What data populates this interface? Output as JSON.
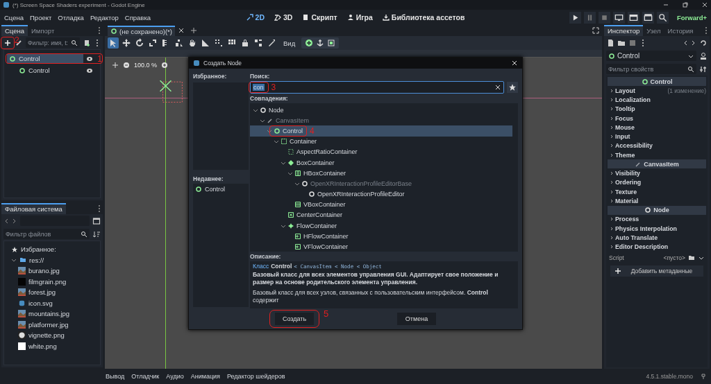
{
  "window": {
    "title": "(*) Screen Space Shaders experiment - Godot Engine"
  },
  "menu": [
    "Сцена",
    "Проект",
    "Отладка",
    "Редактор",
    "Справка"
  ],
  "workspaces": [
    {
      "label": "2D",
      "kind": "canvas",
      "selected": true
    },
    {
      "label": "3D",
      "kind": "cube",
      "selected": false
    },
    {
      "label": "Скрипт",
      "kind": "script",
      "selected": false
    },
    {
      "label": "Игра",
      "kind": "game",
      "selected": false
    },
    {
      "label": "Библиотека ассетов",
      "kind": "assets",
      "selected": false
    }
  ],
  "renderer": "Forward+",
  "scene_dock": {
    "tabs": [
      {
        "label": "Сцена",
        "selected": true
      },
      {
        "label": "Импорт",
        "selected": false
      }
    ],
    "add_callout": "2",
    "filter_placeholder": "Фильтр: имя, t:",
    "tree": [
      {
        "name": "Control",
        "selected": true,
        "callout": "1",
        "children": [
          {
            "name": "Control",
            "selected": false
          }
        ]
      }
    ]
  },
  "filesystem": {
    "tab": "Файловая система",
    "filter_placeholder": "Фильтр файлов",
    "favorites": "Избранное:",
    "root": {
      "name": "res://",
      "expanded": true,
      "children": [
        {
          "name": "burano.jpg",
          "kind": "photo"
        },
        {
          "name": "filmgrain.png",
          "kind": "dark"
        },
        {
          "name": "forest.jpg",
          "kind": "photo"
        },
        {
          "name": "icon.svg",
          "kind": "logo"
        },
        {
          "name": "mountains.jpg",
          "kind": "photo"
        },
        {
          "name": "platformer.jpg",
          "kind": "photo"
        },
        {
          "name": "vignette.png",
          "kind": "vignette"
        },
        {
          "name": "white.png",
          "kind": "white"
        }
      ]
    }
  },
  "editor": {
    "tab": "(не сохранено)(*)",
    "view_menu": "Вид",
    "zoom": "100.0 %"
  },
  "dialog": {
    "title": "Создать Node",
    "favorites_label": "Избранное:",
    "recent_label": "Недавнее:",
    "recent": [
      "Control"
    ],
    "search_label": "Поиск:",
    "search_value": "con",
    "search_callout": "3",
    "matches_label": "Совпадения:",
    "tree": [
      {
        "name": "Node",
        "kind": "node",
        "expanded": true,
        "selected": false,
        "disabled": false,
        "children": [
          {
            "name": "CanvasItem",
            "kind": "pencil",
            "expanded": true,
            "selected": false,
            "disabled": true,
            "children": [
              {
                "name": "Control",
                "kind": "control",
                "expanded": true,
                "selected": true,
                "disabled": false,
                "callout": "4",
                "children": [
                  {
                    "name": "Container",
                    "kind": "container",
                    "expanded": true,
                    "selected": false,
                    "disabled": false,
                    "children": [
                      {
                        "name": "AspectRatioContainer",
                        "kind": "dotted",
                        "selected": false,
                        "disabled": false
                      },
                      {
                        "name": "BoxContainer",
                        "kind": "diamond",
                        "expanded": true,
                        "selected": false,
                        "disabled": false,
                        "children": [
                          {
                            "name": "HBoxContainer",
                            "kind": "hbox",
                            "expanded": true,
                            "selected": false,
                            "disabled": false,
                            "children": [
                              {
                                "name": "OpenXRInteractionProfileEditorBase",
                                "kind": "node",
                                "expanded": true,
                                "selected": false,
                                "disabled": true,
                                "children": [
                                  {
                                    "name": "OpenXRInteractionProfileEditor",
                                    "kind": "node",
                                    "selected": false,
                                    "disabled": false
                                  }
                                ]
                              }
                            ]
                          },
                          {
                            "name": "VBoxContainer",
                            "kind": "vbox",
                            "selected": false,
                            "disabled": false
                          }
                        ]
                      },
                      {
                        "name": "CenterContainer",
                        "kind": "center",
                        "selected": false,
                        "disabled": false
                      },
                      {
                        "name": "FlowContainer",
                        "kind": "flow",
                        "expanded": true,
                        "selected": false,
                        "disabled": false,
                        "children": [
                          {
                            "name": "HFlowContainer",
                            "kind": "hflow",
                            "selected": false,
                            "disabled": false
                          },
                          {
                            "name": "VFlowContainer",
                            "kind": "hflow",
                            "selected": false,
                            "disabled": false
                          }
                        ]
                      }
                    ]
                  }
                ]
              }
            ]
          }
        ]
      }
    ],
    "description_label": "Описание:",
    "description": {
      "class_word": "Класс",
      "class_name": "Control",
      "inheritance": "< CanvasItem < Node < Object",
      "summary": "Базовый класс для всех элементов управления GUI. Адаптирует свое положение и размер на основе родительского элемента управления.",
      "body": "Базовый класс для всех узлов, связанных с пользовательским интерфейсом. **Control** содержит"
    },
    "create_button": "Создать",
    "create_callout": "5",
    "cancel_button": "Отмена"
  },
  "inspector": {
    "tabs": [
      {
        "label": "Инспектор",
        "selected": true
      },
      {
        "label": "Узел",
        "selected": false
      },
      {
        "label": "История",
        "selected": false
      }
    ],
    "node": "Control",
    "filter_placeholder": "Фильтр свойств",
    "sections": [
      {
        "title": "Control",
        "kind": "control",
        "groups": [
          {
            "label": "Layout",
            "note": "(1 изменение)"
          },
          {
            "label": "Localization"
          },
          {
            "label": "Tooltip"
          },
          {
            "label": "Focus"
          },
          {
            "label": "Mouse"
          },
          {
            "label": "Input"
          },
          {
            "label": "Accessibility"
          },
          {
            "label": "Theme"
          }
        ]
      },
      {
        "title": "CanvasItem",
        "kind": "canvasitem",
        "groups": [
          {
            "label": "Visibility"
          },
          {
            "label": "Ordering"
          },
          {
            "label": "Texture"
          },
          {
            "label": "Material"
          }
        ]
      },
      {
        "title": "Node",
        "kind": "node",
        "groups": [
          {
            "label": "Process"
          },
          {
            "label": "Physics Interpolation"
          },
          {
            "label": "Auto Translate"
          },
          {
            "label": "Editor Description"
          }
        ]
      }
    ],
    "script_label": "Script",
    "script_value": "<пусто>",
    "add_metadata": "Добавить метаданные"
  },
  "bottom_panel": {
    "tabs": [
      "Вывод",
      "Отладчик",
      "Аудио",
      "Анимация",
      "Редактор шейдеров"
    ],
    "version": "4.5.1.stable.mono"
  }
}
